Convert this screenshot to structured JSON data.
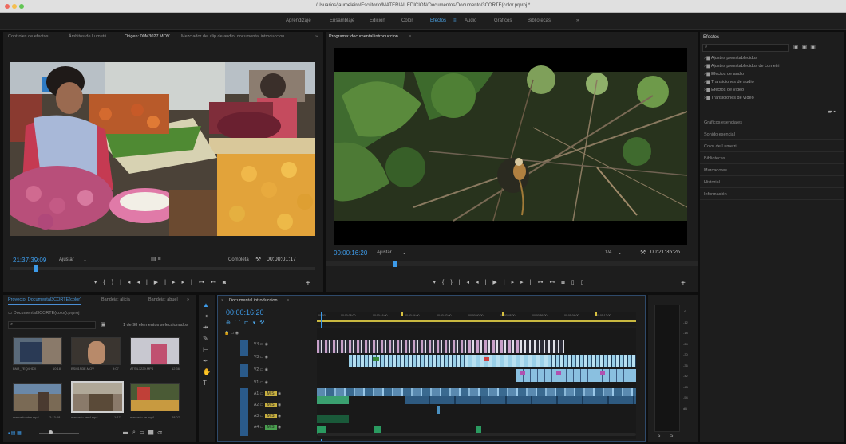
{
  "window": {
    "title": "/Usuarios/jaumeleiro/Escritorio/MATERIAL  EDICIÓN/Documentos/Documento/3CORTE(color.prproj *"
  },
  "workspaces": {
    "items": [
      "Aprendizaje",
      "Ensamblaje",
      "Edición",
      "Color",
      "Efectos",
      "Audio",
      "Gráficos",
      "Bibliotecas"
    ],
    "active": "Efectos",
    "more": "»"
  },
  "source": {
    "tabs": [
      "Controles de efectos",
      "Ámbitos de Lumetri",
      "Origen: 00M3027.MOV",
      "Mezclador del clip de audio: documental introduccion"
    ],
    "more": "»",
    "timecode": "21:37:39:09",
    "fit": "Ajustar",
    "quality": "Completa",
    "duration": "00;00;01;17"
  },
  "program": {
    "tab": "Programa: documental introduccion",
    "timecode": "00:00:16:20",
    "fit": "Ajustar",
    "quality": "1/4",
    "duration": "00:21:35:26"
  },
  "effects": {
    "title": "Efectos",
    "search_placeholder": "",
    "items": [
      "Ajustes preestablecidos",
      "Ajustes preestablecidos de Lumetri",
      "Efectos de audio",
      "Transiciones de audio",
      "Efectos de vídeo",
      "Transiciones de vídeo"
    ],
    "sections": [
      "Gráficos esenciales",
      "Sonido esencial",
      "Color de Lumetri",
      "Bibliotecas",
      "Marcadores",
      "Historial",
      "Información"
    ]
  },
  "project": {
    "tabs": [
      "Proyecto: Documental3CORTE(color)",
      "Bandeja: alicia",
      "Bandeja: abuel"
    ],
    "more": "»",
    "file": "Documental3CORTE(color).prproj",
    "count": "1 de 98 elementos seleccionados",
    "thumbs": [
      {
        "name": "BNR_7EQ4HDX",
        "dur": "10:18"
      },
      {
        "name": "BSM1N3E.MOV",
        "dur": "9:07"
      },
      {
        "name": "ATSIL1229.MP4",
        "dur": "12:36"
      },
      {
        "name": "mercado-otra.mp4",
        "dur": "2:13:08"
      },
      {
        "name": "mercado-verd.mp4",
        "dur": "1:17"
      },
      {
        "name": "mercado-ve.mp4",
        "dur": "28:07"
      }
    ]
  },
  "timeline": {
    "tab": "Documental introduccion",
    "timecode": "00:00:16:20",
    "ruler": [
      "00:00",
      "00:00:08:00",
      "00:00:16:00",
      "00:00:24:00",
      "00:00:32:00",
      "00:00:40:00",
      "00:00:48:00",
      "00:00:56:00",
      "00:01:04:00",
      "00:01:12:00"
    ],
    "video_tracks": [
      "V4",
      "V3",
      "V2",
      "V1"
    ],
    "audio_tracks": [
      "A1",
      "A2",
      "A3",
      "A4"
    ]
  },
  "meter": {
    "labels": [
      "-6",
      "-12",
      "-18",
      "-24",
      "-30",
      "-36",
      "-42",
      "-48",
      "-54",
      "dB"
    ],
    "footer": [
      "S",
      "S"
    ]
  }
}
